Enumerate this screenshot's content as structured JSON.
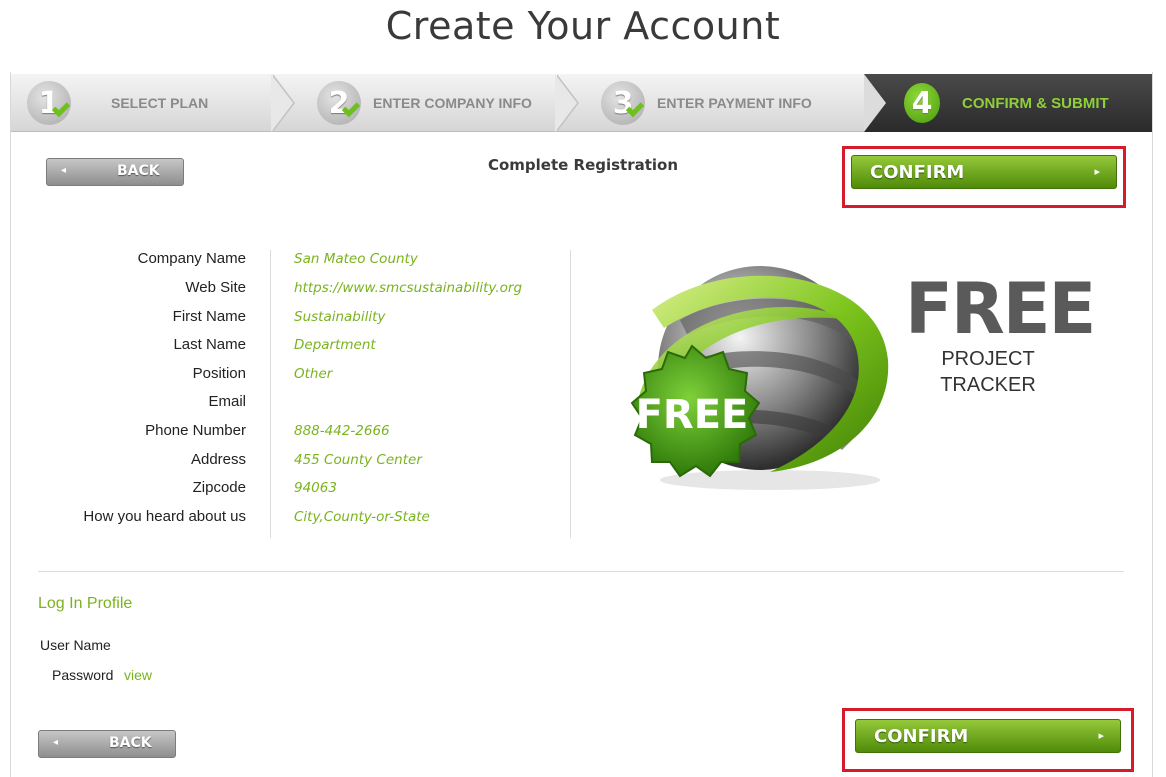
{
  "page": {
    "title": "Create Your Account"
  },
  "steps": [
    {
      "number": "1",
      "label": "SELECT PLAN",
      "completed": true
    },
    {
      "number": "2",
      "label": "ENTER COMPANY INFO",
      "completed": true
    },
    {
      "number": "3",
      "label": "ENTER PAYMENT INFO",
      "completed": true
    },
    {
      "number": "4",
      "label": "CONFIRM & SUBMIT",
      "active": true
    }
  ],
  "actions": {
    "back_label": "BACK",
    "confirm_label": "CONFIRM"
  },
  "registration": {
    "title": "Complete Registration",
    "fields": [
      {
        "label": "Company Name",
        "value": "San Mateo County"
      },
      {
        "label": "Web Site",
        "value": "https://www.smcsustainability.org"
      },
      {
        "label": "First Name",
        "value": "Sustainability"
      },
      {
        "label": "Last Name",
        "value": "Department"
      },
      {
        "label": "Position",
        "value": "Other"
      },
      {
        "label": "Email",
        "value": ""
      },
      {
        "label": "Phone Number",
        "value": "888-442-2666"
      },
      {
        "label": "Address",
        "value": "455 County Center"
      },
      {
        "label": "Zipcode",
        "value": "94063"
      },
      {
        "label": "How you heard about us",
        "value": "City,County-or-State"
      }
    ]
  },
  "promo": {
    "badge": "FREE",
    "headline": "FREE",
    "line1": "PROJECT",
    "line2": "TRACKER"
  },
  "login_profile": {
    "title": "Log In Profile",
    "username_label": "User Name",
    "password_label": "Password",
    "view_link": "view"
  },
  "colors": {
    "accent_green": "#7ab31f",
    "highlight_red": "#d61c2a",
    "confirm_green": "#5f9a12"
  }
}
